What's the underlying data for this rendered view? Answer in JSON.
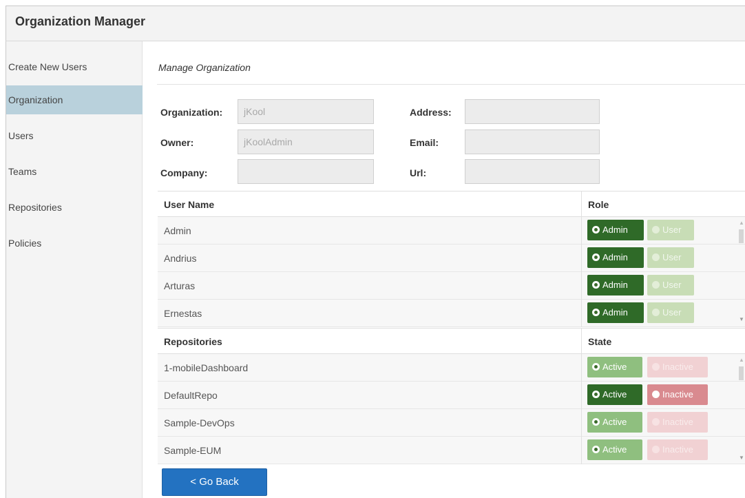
{
  "app": {
    "title": "Organization Manager"
  },
  "sidebar": {
    "items": [
      {
        "label": "Create New Users",
        "active": false
      },
      {
        "label": "Organization",
        "active": true
      },
      {
        "label": "Users",
        "active": false
      },
      {
        "label": "Teams",
        "active": false
      },
      {
        "label": "Repositories",
        "active": false
      },
      {
        "label": "Policies",
        "active": false
      }
    ]
  },
  "main": {
    "section_title": "Manage Organization",
    "form": {
      "organization": {
        "label": "Organization:",
        "value": "jKool"
      },
      "owner": {
        "label": "Owner:",
        "value": "jKoolAdmin"
      },
      "company": {
        "label": "Company:",
        "value": ""
      },
      "address": {
        "label": "Address:",
        "value": ""
      },
      "email": {
        "label": "Email:",
        "value": ""
      },
      "url": {
        "label": "Url:",
        "value": ""
      }
    },
    "users_table": {
      "col1": "User Name",
      "col2": "Role",
      "option_a": "Admin",
      "option_b": "User",
      "rows": [
        {
          "name": "Admin",
          "role": "Admin"
        },
        {
          "name": "Andrius",
          "role": "Admin"
        },
        {
          "name": "Arturas",
          "role": "Admin"
        },
        {
          "name": "Ernestas",
          "role": "Admin"
        }
      ]
    },
    "repos_table": {
      "col1": "Repositories",
      "col2": "State",
      "option_a": "Active",
      "option_b": "Inactive",
      "rows": [
        {
          "name": "1-mobileDashboard",
          "state": "Active",
          "enabled": false
        },
        {
          "name": "DefaultRepo",
          "state": "Active",
          "enabled": true
        },
        {
          "name": "Sample-DevOps",
          "state": "Active",
          "enabled": false
        },
        {
          "name": "Sample-EUM",
          "state": "Active",
          "enabled": false
        }
      ]
    },
    "back_button": "< Go Back"
  },
  "colors": {
    "accent": "#2372c1",
    "sidebar_active": "#b9d1dc",
    "toggle_on": "#2f6a28",
    "toggle_inactive": "#d98a8f"
  }
}
